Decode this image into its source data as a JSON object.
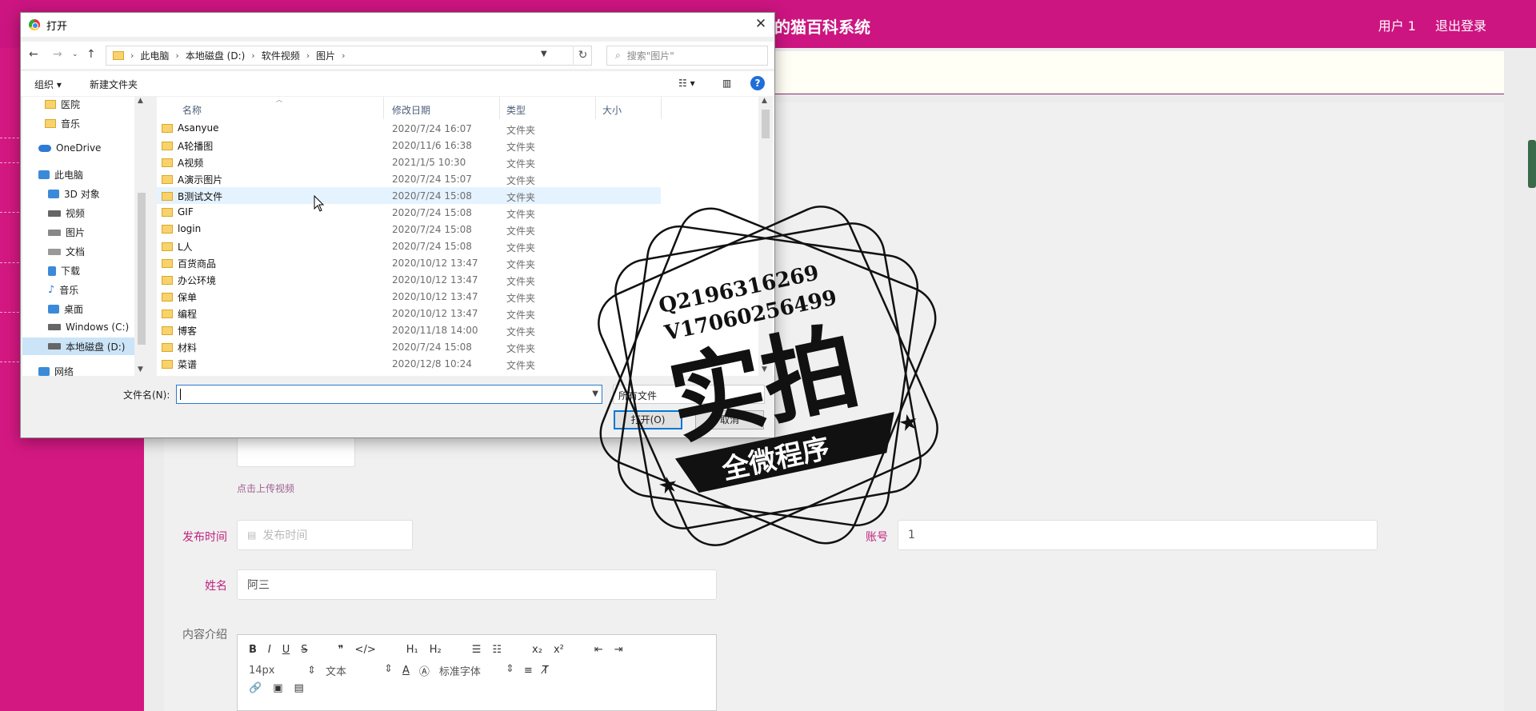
{
  "app": {
    "title": "的猫百科系统",
    "user_label": "用户 1",
    "logout_label": "退出登录"
  },
  "form": {
    "upload_hint": "点击上传视频",
    "publish_time_label": "发布时间",
    "publish_time_placeholder": "发布时间",
    "account_label": "账号",
    "account_value": "1",
    "name_label": "姓名",
    "name_value": "阿三",
    "content_label": "内容介绍"
  },
  "editor": {
    "font_size": "14px",
    "text_style": "文本",
    "font_family": "标准字体"
  },
  "dialog": {
    "title": "打开",
    "breadcrumb": [
      "此电脑",
      "本地磁盘 (D:)",
      "软件视频",
      "图片"
    ],
    "search_placeholder": "搜索\"图片\"",
    "organize_label": "组织 ▾",
    "new_folder_label": "新建文件夹",
    "nav_items": [
      {
        "label": "医院",
        "icon": "folder-icon"
      },
      {
        "label": "音乐",
        "icon": "folder-icon"
      },
      {
        "label": "OneDrive",
        "icon": "cloud-icon"
      },
      {
        "label": "此电脑",
        "icon": "computer-icon"
      },
      {
        "label": "3D 对象",
        "icon": "cube-icon"
      },
      {
        "label": "视频",
        "icon": "video-icon"
      },
      {
        "label": "图片",
        "icon": "picture-icon"
      },
      {
        "label": "文档",
        "icon": "document-icon"
      },
      {
        "label": "下载",
        "icon": "download-icon"
      },
      {
        "label": "音乐",
        "icon": "music-icon"
      },
      {
        "label": "桌面",
        "icon": "desktop-icon"
      },
      {
        "label": "Windows (C:)",
        "icon": "drive-icon"
      },
      {
        "label": "本地磁盘 (D:)",
        "icon": "drive-icon"
      },
      {
        "label": "网络",
        "icon": "network-icon"
      }
    ],
    "columns": {
      "name": "名称",
      "modified": "修改日期",
      "type": "类型",
      "size": "大小"
    },
    "files": [
      {
        "name": "Asanyue",
        "date": "2020/7/24 16:07",
        "type": "文件夹"
      },
      {
        "name": "A轮播图",
        "date": "2020/11/6 16:38",
        "type": "文件夹"
      },
      {
        "name": "A视频",
        "date": "2021/1/5 10:30",
        "type": "文件夹"
      },
      {
        "name": "A演示图片",
        "date": "2020/7/24 15:07",
        "type": "文件夹"
      },
      {
        "name": "B测试文件",
        "date": "2020/7/24 15:08",
        "type": "文件夹"
      },
      {
        "name": "GIF",
        "date": "2020/7/24 15:08",
        "type": "文件夹"
      },
      {
        "name": "login",
        "date": "2020/7/24 15:08",
        "type": "文件夹"
      },
      {
        "name": "L人",
        "date": "2020/7/24 15:08",
        "type": "文件夹"
      },
      {
        "name": "百货商品",
        "date": "2020/10/12 13:47",
        "type": "文件夹"
      },
      {
        "name": "办公环境",
        "date": "2020/10/12 13:47",
        "type": "文件夹"
      },
      {
        "name": "保单",
        "date": "2020/10/12 13:47",
        "type": "文件夹"
      },
      {
        "name": "编程",
        "date": "2020/10/12 13:47",
        "type": "文件夹"
      },
      {
        "name": "博客",
        "date": "2020/11/18 14:00",
        "type": "文件夹"
      },
      {
        "name": "材料",
        "date": "2020/7/24 15:08",
        "type": "文件夹"
      },
      {
        "name": "菜谱",
        "date": "2020/12/8 10:24",
        "type": "文件夹"
      }
    ],
    "filename_label": "文件名(N):",
    "filename_value": "",
    "filetype_value": "所有文件",
    "open_label": "打开(O)",
    "cancel_label": "取消"
  },
  "watermark": {
    "line1": "Q2196316269",
    "line2": "V17060256499",
    "big_text": "实拍",
    "banner": "全微程序"
  }
}
